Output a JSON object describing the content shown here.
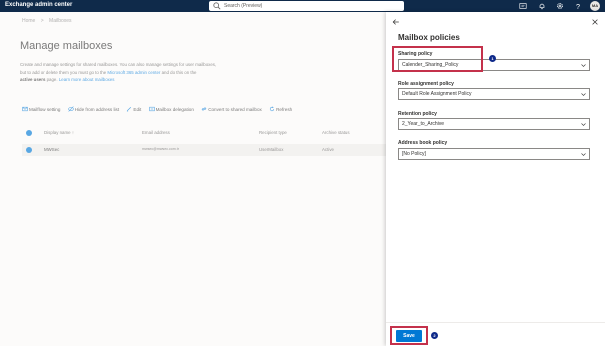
{
  "header": {
    "app_title": "Exchange admin center",
    "search_placeholder": "Search (Preview)",
    "avatar_initials": "MA"
  },
  "breadcrumb": [
    "Home",
    ">",
    "Mailboxes"
  ],
  "main": {
    "page_title": "Manage mailboxes",
    "description_line1": "Create and manage settings for shared mailboxes. You can also manage settings for user mailboxes,",
    "description_line2_a": "but to add or delete them you must go to the ",
    "description_link1": "Microsoft 365 admin center",
    "description_line2_b": " and do this on the",
    "description_bold": "active users",
    "description_line3_a": " page. ",
    "description_link2": "Learn more about mailboxes",
    "commands": {
      "mailflow": "Mailflow setting",
      "hide": "Hide from address list",
      "edit": "Edit",
      "delegation": "Mailbox delegation",
      "convert": "Convert to shared mailbox",
      "refresh": "Refresh"
    },
    "columns": [
      "Display name ↑",
      "Email address",
      "Recipient type",
      "Archive status"
    ],
    "rows": [
      {
        "display_name": "MWSec",
        "email": "mwsec@mwsec.com.tr",
        "recipient_type": "UserMailbox",
        "archive_status": "Active"
      }
    ]
  },
  "panel": {
    "title": "Mailbox policies",
    "sharing_label": "Sharing policy",
    "sharing_value": "Calender_Sharing_Policy",
    "role_label": "Role assignment policy",
    "role_value": "Default Role Assignment Policy",
    "retention_label": "Retention policy",
    "retention_value": "2_Year_to_Archive",
    "address_label": "Address book policy",
    "address_value": "[No Policy]",
    "save_label": "Save",
    "badge1": "1",
    "badge2": "2"
  },
  "colors": {
    "topbar": "#0f2a4a",
    "accent": "#0078d4",
    "highlight": "#c4314b"
  }
}
